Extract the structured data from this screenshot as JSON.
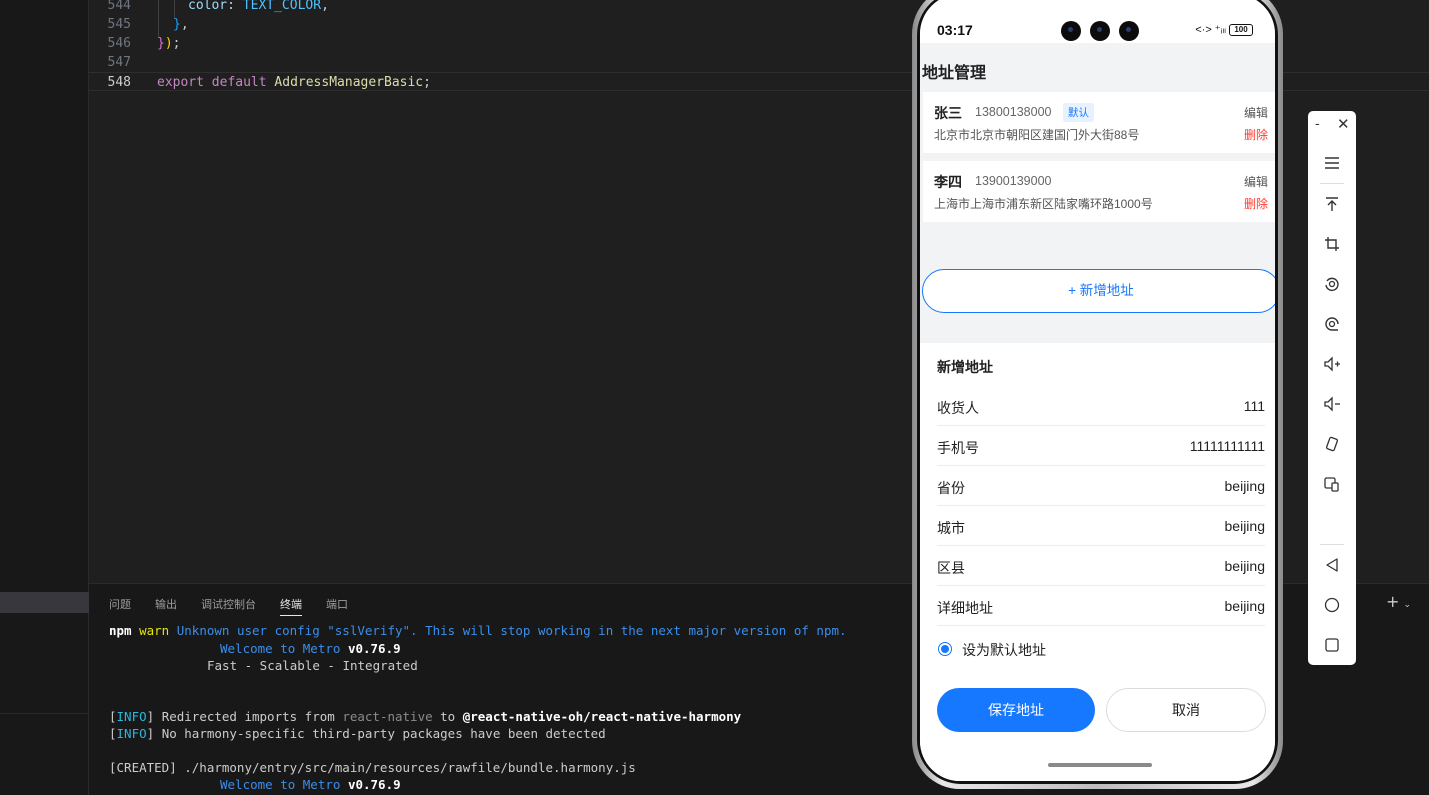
{
  "editor": {
    "lines": [
      {
        "num": "544",
        "code": "color: TEXT_COLOR,"
      },
      {
        "num": "545",
        "code": "},"
      },
      {
        "num": "546",
        "code": "});"
      },
      {
        "num": "547",
        "code": ""
      },
      {
        "num": "548",
        "code": "export default AddressManagerBasic;"
      }
    ],
    "line544": {
      "prop": "color",
      "colon": ": ",
      "value": "TEXT_COLOR",
      "comma": ","
    },
    "line545": {
      "brace": "}",
      "comma": ","
    },
    "line546": {
      "brace": "}",
      "paren": ")",
      "semi": ";"
    },
    "line548": {
      "kw1": "export",
      "kw2": "default",
      "name": "AddressManagerBasic",
      "semi": ";"
    }
  },
  "panel": {
    "tabs": [
      "问题",
      "输出",
      "调试控制台",
      "终端",
      "端口"
    ],
    "active_tab": "终端",
    "add_icon": "+",
    "terminal": {
      "l1_a": "npm ",
      "l1_b": "warn",
      "l1_c": " Unknown user config \"sslVerify\". This will stop working in the next major version of npm.",
      "l2_a": "Welcome to Metro",
      "l2_b": " v0.76.9",
      "l3": "Fast - Scalable - Integrated",
      "l4_a": "[",
      "l4_b": "INFO",
      "l4_c": "] Redirected imports from ",
      "l4_d": "react-native",
      "l4_e": " to ",
      "l4_f": "@react-native-oh/react-native-harmony",
      "l5_a": "[",
      "l5_b": "INFO",
      "l5_c": "] No harmony-specific third-party packages have been detected",
      "l6": "[CREATED] ./harmony/entry/src/main/resources/rawfile/bundle.harmony.js",
      "l7_a": "Welcome to Metro",
      "l7_b": " v0.76.9"
    }
  },
  "phone": {
    "status": {
      "time": "03:17",
      "icons": "<·> ⁺ᵢₗₗ",
      "battery": "100"
    },
    "title": "地址管理",
    "addresses": [
      {
        "name": "张三",
        "phone": "13800138000",
        "badge": "默认",
        "address": "北京市北京市朝阳区建国门外大街88号",
        "edit": "编辑",
        "delete": "删除"
      },
      {
        "name": "李四",
        "phone": "13900139000",
        "address": "上海市上海市浦东新区陆家嘴环路1000号",
        "edit": "编辑",
        "delete": "删除"
      }
    ],
    "add_button": "+ 新增地址",
    "form": {
      "title": "新增地址",
      "fields": [
        {
          "label": "收货人",
          "value": "111"
        },
        {
          "label": "手机号",
          "value": "11111111111"
        },
        {
          "label": "省份",
          "value": "beijing"
        },
        {
          "label": "城市",
          "value": "beijing"
        },
        {
          "label": "区县",
          "value": "beijing"
        },
        {
          "label": "详细地址",
          "value": "beijing"
        }
      ],
      "default_label": "设为默认地址",
      "default_checked": true,
      "save": "保存地址",
      "cancel": "取消"
    }
  },
  "toolbar": {
    "minimize": "-",
    "close": "✕",
    "icons": [
      "menu-icon",
      "pin-top-icon",
      "screenshot-crop-icon",
      "rotate-icon",
      "record-icon",
      "volume-up-icon",
      "volume-down-icon",
      "shake-icon",
      "multi-device-icon",
      "back-icon",
      "home-icon",
      "recents-icon"
    ]
  },
  "colors": {
    "accent": "#1677ff",
    "delete": "#ff3b30",
    "editor_bg": "#1f1f1f"
  }
}
